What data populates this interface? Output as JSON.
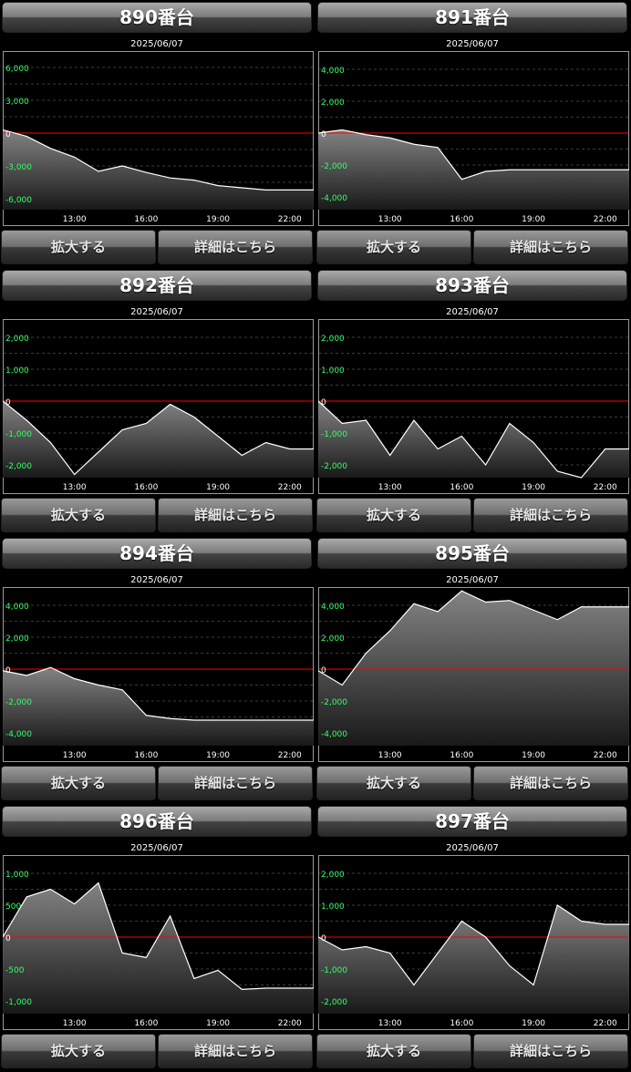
{
  "ui": {
    "zoom_label": "拡大する",
    "detail_label": "詳細はこちら",
    "x_tick_labels": [
      "13:00",
      "16:00",
      "19:00",
      "22:00"
    ]
  },
  "colors": {
    "background": "#000000",
    "zero_line": "#ff0000",
    "axis_label": "#33ff66",
    "series_line": "#ffffff"
  },
  "chart_data": [
    {
      "type": "area",
      "machine": "890番台",
      "date": "2025/06/07",
      "x": [
        "10:00",
        "11:00",
        "12:00",
        "13:00",
        "14:00",
        "15:00",
        "16:00",
        "17:00",
        "18:00",
        "19:00",
        "20:00",
        "21:00",
        "22:00",
        "23:00"
      ],
      "values": [
        300,
        -300,
        -1400,
        -2200,
        -3500,
        -3000,
        -3600,
        -4100,
        -4300,
        -4800,
        -5000,
        -5200,
        -5200,
        -5200
      ],
      "ylim": [
        -7000,
        7000
      ],
      "yticks": [
        6000,
        3000,
        0,
        -3000,
        -6000
      ],
      "ytick_labels": [
        "6,000",
        "3,000",
        "0",
        "-3,000",
        "-6,000"
      ],
      "grid": true
    },
    {
      "type": "area",
      "machine": "891番台",
      "date": "2025/06/07",
      "x": [
        "10:00",
        "11:00",
        "12:00",
        "13:00",
        "14:00",
        "15:00",
        "16:00",
        "17:00",
        "18:00",
        "19:00",
        "20:00",
        "21:00",
        "22:00",
        "23:00"
      ],
      "values": [
        0,
        200,
        -100,
        -300,
        -700,
        -900,
        -2900,
        -2400,
        -2300,
        -2300,
        -2300,
        -2300,
        -2300,
        -2300
      ],
      "ylim": [
        -4800,
        4800
      ],
      "yticks": [
        4000,
        2000,
        0,
        -2000,
        -4000
      ],
      "ytick_labels": [
        "4,000",
        "2,000",
        "0",
        "-2,000",
        "-4,000"
      ],
      "grid": true
    },
    {
      "type": "area",
      "machine": "892番台",
      "date": "2025/06/07",
      "x": [
        "10:00",
        "11:00",
        "12:00",
        "13:00",
        "14:00",
        "15:00",
        "16:00",
        "17:00",
        "18:00",
        "19:00",
        "20:00",
        "21:00",
        "22:00",
        "23:00"
      ],
      "values": [
        0,
        -600,
        -1300,
        -2300,
        -1600,
        -900,
        -700,
        -100,
        -500,
        -1100,
        -1700,
        -1300,
        -1500,
        -1500
      ],
      "ylim": [
        -2400,
        2400
      ],
      "yticks": [
        2000,
        1000,
        0,
        -1000,
        -2000
      ],
      "ytick_labels": [
        "2,000",
        "1,000",
        "0",
        "-1,000",
        "-2,000"
      ],
      "grid": true
    },
    {
      "type": "area",
      "machine": "893番台",
      "date": "2025/06/07",
      "x": [
        "10:00",
        "11:00",
        "12:00",
        "13:00",
        "14:00",
        "15:00",
        "16:00",
        "17:00",
        "18:00",
        "19:00",
        "20:00",
        "21:00",
        "22:00",
        "23:00"
      ],
      "values": [
        0,
        -700,
        -600,
        -1700,
        -600,
        -1500,
        -1100,
        -2000,
        -700,
        -1300,
        -2200,
        -2400,
        -1500,
        -1500
      ],
      "ylim": [
        -2400,
        2400
      ],
      "yticks": [
        2000,
        1000,
        0,
        -1000,
        -2000
      ],
      "ytick_labels": [
        "2,000",
        "1,000",
        "0",
        "-1,000",
        "-2,000"
      ],
      "grid": true
    },
    {
      "type": "area",
      "machine": "894番台",
      "date": "2025/06/07",
      "x": [
        "10:00",
        "11:00",
        "12:00",
        "13:00",
        "14:00",
        "15:00",
        "16:00",
        "17:00",
        "18:00",
        "19:00",
        "20:00",
        "21:00",
        "22:00",
        "23:00"
      ],
      "values": [
        -100,
        -400,
        100,
        -600,
        -1000,
        -1300,
        -2900,
        -3100,
        -3200,
        -3200,
        -3200,
        -3200,
        -3200,
        -3200
      ],
      "ylim": [
        -4800,
        4800
      ],
      "yticks": [
        4000,
        2000,
        0,
        -2000,
        -4000
      ],
      "ytick_labels": [
        "4,000",
        "2,000",
        "0",
        "-2,000",
        "-4,000"
      ],
      "grid": true
    },
    {
      "type": "area",
      "machine": "895番台",
      "date": "2025/06/07",
      "x": [
        "10:00",
        "11:00",
        "12:00",
        "13:00",
        "14:00",
        "15:00",
        "16:00",
        "17:00",
        "18:00",
        "19:00",
        "20:00",
        "21:00",
        "22:00",
        "23:00"
      ],
      "values": [
        -100,
        -1000,
        1000,
        2400,
        4100,
        3600,
        4900,
        4200,
        4300,
        3700,
        3100,
        3900,
        3900,
        3900
      ],
      "ylim": [
        -4800,
        4800
      ],
      "yticks": [
        4000,
        2000,
        0,
        -2000,
        -4000
      ],
      "ytick_labels": [
        "4,000",
        "2,000",
        "0",
        "-2,000",
        "-4,000"
      ],
      "grid": true
    },
    {
      "type": "area",
      "machine": "896番台",
      "date": "2025/06/07",
      "x": [
        "10:00",
        "11:00",
        "12:00",
        "13:00",
        "14:00",
        "15:00",
        "16:00",
        "17:00",
        "18:00",
        "19:00",
        "20:00",
        "21:00",
        "22:00",
        "23:00"
      ],
      "values": [
        0,
        630,
        750,
        520,
        850,
        -250,
        -320,
        330,
        -650,
        -520,
        -820,
        -800,
        -800,
        -800
      ],
      "ylim": [
        -1200,
        1200
      ],
      "yticks": [
        1000,
        500,
        0,
        -500,
        -1000
      ],
      "ytick_labels": [
        "1,000",
        "500",
        "0",
        "-500",
        "-1,000"
      ],
      "grid": true
    },
    {
      "type": "area",
      "machine": "897番台",
      "date": "2025/06/07",
      "x": [
        "10:00",
        "11:00",
        "12:00",
        "13:00",
        "14:00",
        "15:00",
        "16:00",
        "17:00",
        "18:00",
        "19:00",
        "20:00",
        "21:00",
        "22:00",
        "23:00"
      ],
      "values": [
        0,
        -400,
        -300,
        -500,
        -1500,
        -500,
        500,
        0,
        -900,
        -1500,
        1000,
        500,
        400,
        400
      ],
      "ylim": [
        -2400,
        2400
      ],
      "yticks": [
        2000,
        1000,
        0,
        -1000,
        -2000
      ],
      "ytick_labels": [
        "2,000",
        "1,000",
        "0",
        "-1,000",
        "-2,000"
      ],
      "grid": true
    }
  ]
}
